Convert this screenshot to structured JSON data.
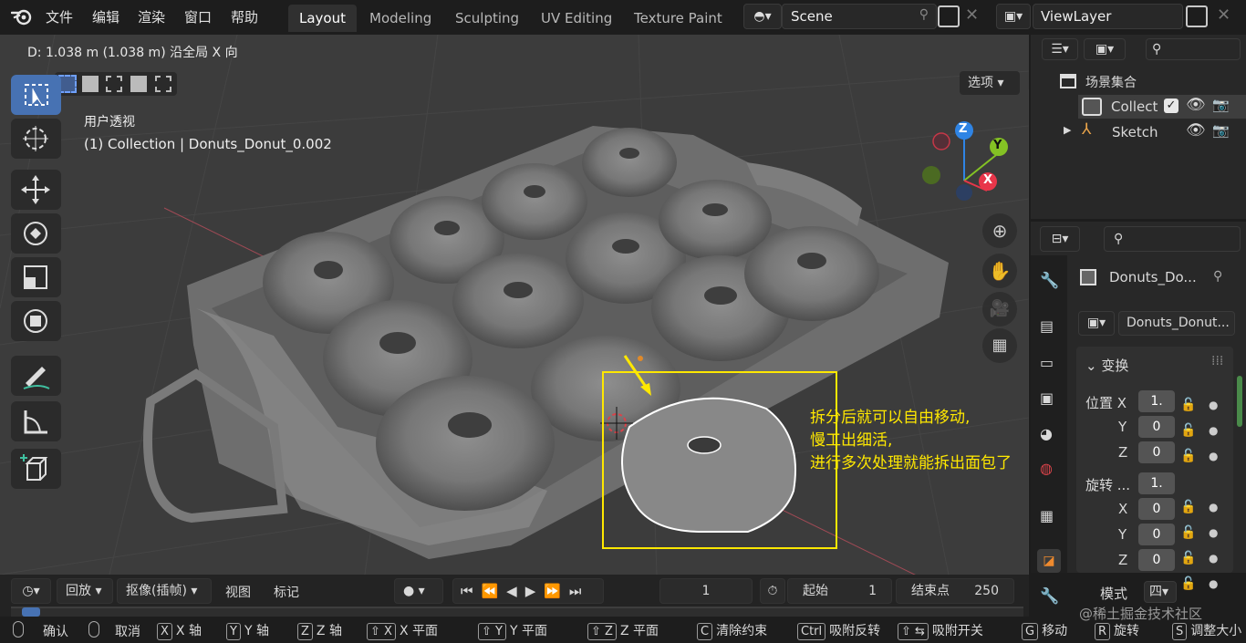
{
  "top_menu": [
    "文件",
    "编辑",
    "渲染",
    "窗口",
    "帮助"
  ],
  "workspaces": [
    "Layout",
    "Modeling",
    "Sculpting",
    "UV Editing",
    "Texture Paint"
  ],
  "scene": "Scene",
  "view_layer": "ViewLayer",
  "viewport": {
    "header_info": "D: 1.038 m (1.038 m) 沿全局 X 向",
    "options_label": "选项",
    "view_name": "用户透视",
    "collection_info": "(1) Collection | Donuts_Donut_0.002",
    "annotation": [
      "拆分后就可以自由移动,",
      "慢工出细活,",
      "进行多次处理就能拆出面包了"
    ],
    "gizmo": {
      "x": "X",
      "y": "Y",
      "z": "Z"
    },
    "colors": {
      "annotation": "#ffe800",
      "x_axis": "#e8364a",
      "y_axis": "#84c224",
      "z_axis": "#2f84e4"
    }
  },
  "tools": [
    "select-box",
    "cursor",
    "move",
    "rotate",
    "scale",
    "transform",
    "annotate",
    "measure",
    "add-cube"
  ],
  "outliner": {
    "scene_collection": "场景集合",
    "items": [
      {
        "name": "Collect"
      },
      {
        "name": "Sketch"
      }
    ]
  },
  "properties": {
    "object_name": "Donuts_Do...",
    "mesh_name": "Donuts_Donut...",
    "section": "变换",
    "location": {
      "label": "位置 X",
      "x": "1.",
      "y": "0",
      "z": "0"
    },
    "rotation": {
      "label": "旋转 ...",
      "x": "1.",
      "y": "0",
      "z": "0"
    },
    "mode": {
      "label": "模式",
      "value": "四"
    },
    "axis": {
      "y": "Y",
      "z": "Z",
      "x": "X"
    }
  },
  "timeline": {
    "playback": "回放",
    "keying": "抠像(插帧)",
    "view": "视图",
    "marker": "标记",
    "current_frame": "1",
    "start_label": "起始",
    "start": "1",
    "end_label": "结束点",
    "end": "250"
  },
  "status_bar": [
    {
      "key": "",
      "label": "确认"
    },
    {
      "key": "",
      "label": "取消"
    },
    {
      "key": "X",
      "label": "X 轴"
    },
    {
      "key": "Y",
      "label": "Y 轴"
    },
    {
      "key": "Z",
      "label": "Z 轴"
    },
    {
      "key": "⇧ X",
      "label": "X 平面"
    },
    {
      "key": "⇧ Y",
      "label": "Y 平面"
    },
    {
      "key": "⇧ Z",
      "label": "Z 平面"
    },
    {
      "key": "C",
      "label": "清除约束"
    },
    {
      "key": "Ctrl",
      "label": "吸附反转"
    },
    {
      "key": "⇧ ⇆",
      "label": "吸附开关"
    },
    {
      "key": "G",
      "label": "移动"
    },
    {
      "key": "R",
      "label": "旋转"
    },
    {
      "key": "S",
      "label": "调整大小"
    }
  ],
  "watermark": "@稀土掘金技术社区"
}
